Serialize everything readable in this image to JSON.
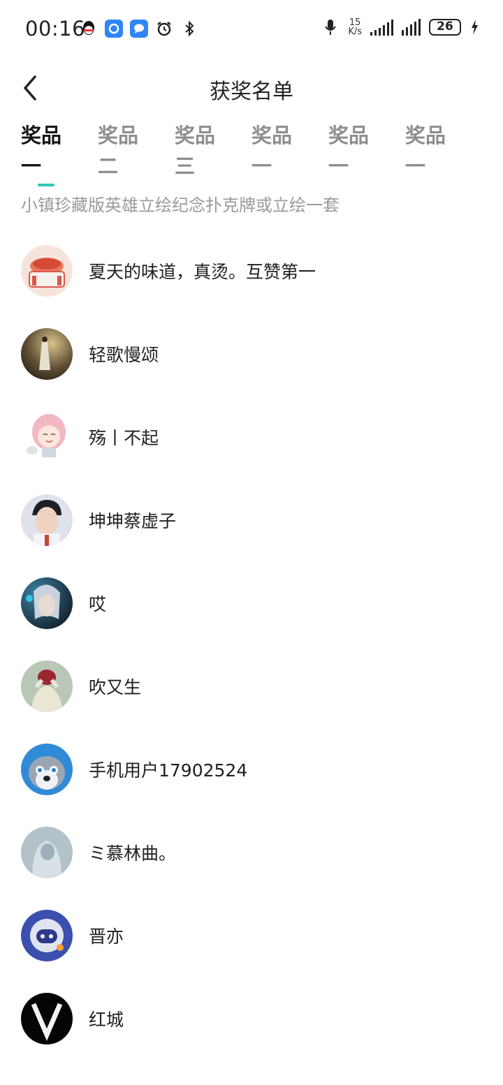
{
  "status": {
    "time": "00:16",
    "net_speed_value": "15",
    "net_speed_unit": "K/s",
    "battery": "26"
  },
  "header": {
    "title": "获奖名单"
  },
  "tabs": [
    {
      "label": "奖品\n一",
      "active": true
    },
    {
      "label": "奖品\n二",
      "active": false
    },
    {
      "label": "奖品\n三",
      "active": false
    },
    {
      "label": "奖品\n一",
      "active": false
    },
    {
      "label": "奖品\n一",
      "active": false
    },
    {
      "label": "奖品\n一",
      "active": false
    }
  ],
  "prize_description": "小镇珍藏版英雄立绘纪念扑克牌或立绘一套",
  "winners": [
    {
      "name": "夏天的味道，真烫。互赞第一",
      "avatar_color": "#f3c9b8"
    },
    {
      "name": "轻歌慢颂",
      "avatar_color": "#6b5a3e"
    },
    {
      "name": "殇丨不起",
      "avatar_color": "#f4d6dc"
    },
    {
      "name": "坤坤蔡虚子",
      "avatar_color": "#c9ccd6"
    },
    {
      "name": "哎",
      "avatar_color": "#2b3a4a"
    },
    {
      "name": "吹又生",
      "avatar_color": "#b7c4b1"
    },
    {
      "name": "手机用户17902524",
      "avatar_color": "#3a8fd6"
    },
    {
      "name": "ミ慕林曲。",
      "avatar_color": "#aab8c0"
    },
    {
      "name": "晋亦",
      "avatar_color": "#3b4ea8"
    },
    {
      "name": "红城",
      "avatar_color": "#050505"
    }
  ]
}
